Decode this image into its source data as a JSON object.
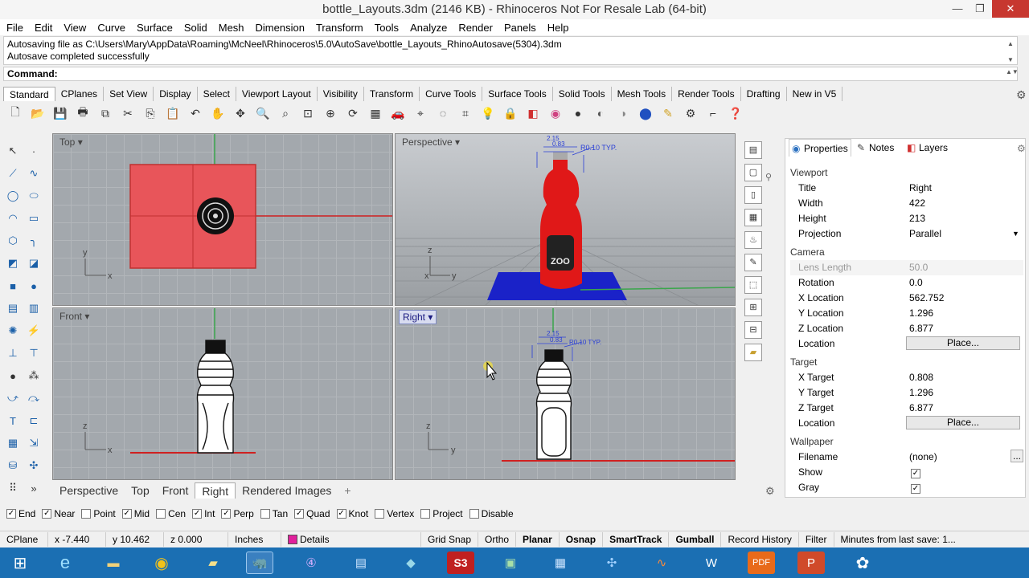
{
  "window": {
    "title": "bottle_Layouts.3dm (2146 KB) - Rhinoceros Not For Resale Lab (64-bit)"
  },
  "menu": [
    "File",
    "Edit",
    "View",
    "Curve",
    "Surface",
    "Solid",
    "Mesh",
    "Dimension",
    "Transform",
    "Tools",
    "Analyze",
    "Render",
    "Panels",
    "Help"
  ],
  "history": {
    "line1": "Autosaving file as C:\\Users\\Mary\\AppData\\Roaming\\McNeel\\Rhinoceros\\5.0\\AutoSave\\bottle_Layouts_RhinoAutosave(5304).3dm",
    "line2": "Autosave completed successfully",
    "command_label": "Command:"
  },
  "toolbar_tabs": [
    "Standard",
    "CPlanes",
    "Set View",
    "Display",
    "Select",
    "Viewport Layout",
    "Visibility",
    "Transform",
    "Curve Tools",
    "Surface Tools",
    "Solid Tools",
    "Mesh Tools",
    "Render Tools",
    "Drafting",
    "New in V5"
  ],
  "toolbar_icons": [
    "new-icon",
    "open-icon",
    "save-icon",
    "print-icon",
    "import-icon",
    "cut-icon",
    "copy-icon",
    "paste-icon",
    "undo-icon",
    "pan-icon",
    "rotate-view-icon",
    "zoom-icon",
    "zoom-window-icon",
    "zoom-extents-icon",
    "zoom-selected-icon",
    "rotate-icon",
    "grid-icon",
    "car-icon",
    "cplane-icon",
    "point-icon",
    "cage-icon",
    "light-icon",
    "lock-icon",
    "layer-icon",
    "color-icon",
    "shaded-icon",
    "rendered-icon",
    "render-icon",
    "sphere-icon",
    "lamp-icon",
    "options-icon",
    "snap-icon",
    "help-icon"
  ],
  "viewports": {
    "top": "Top",
    "perspective": "Perspective",
    "front": "Front",
    "right": "Right",
    "annotation": "R0.10 TYP.",
    "dim1": "2.15",
    "dim2": "0.83",
    "zoo_label": "ZOO"
  },
  "viewport_tabs": [
    "Perspective",
    "Top",
    "Front",
    "Right",
    "Rendered Images"
  ],
  "viewport_tabs_add": "+",
  "osnap": [
    {
      "label": "End",
      "checked": true
    },
    {
      "label": "Near",
      "checked": true
    },
    {
      "label": "Point",
      "checked": false
    },
    {
      "label": "Mid",
      "checked": true
    },
    {
      "label": "Cen",
      "checked": false
    },
    {
      "label": "Int",
      "checked": true
    },
    {
      "label": "Perp",
      "checked": true
    },
    {
      "label": "Tan",
      "checked": false
    },
    {
      "label": "Quad",
      "checked": true
    },
    {
      "label": "Knot",
      "checked": true
    },
    {
      "label": "Vertex",
      "checked": false
    },
    {
      "label": "Project",
      "checked": false
    },
    {
      "label": "Disable",
      "checked": false
    }
  ],
  "status": {
    "cplane": "CPlane",
    "x": "x -7.440",
    "y": "y 10.462",
    "z": "z 0.000",
    "units": "Inches",
    "layer": "Details",
    "layer_color": "#e0209c",
    "grid_snap": "Grid Snap",
    "ortho": "Ortho",
    "planar": "Planar",
    "osnap": "Osnap",
    "smarttrack": "SmartTrack",
    "gumball": "Gumball",
    "record_history": "Record History",
    "filter": "Filter",
    "minutes": "Minutes from last save: 1..."
  },
  "panel": {
    "tabs": [
      "Properties",
      "Notes",
      "Layers"
    ],
    "viewport_section": "Viewport",
    "camera_section": "Camera",
    "target_section": "Target",
    "wallpaper_section": "Wallpaper",
    "rows": {
      "title": {
        "label": "Title",
        "value": "Right"
      },
      "width": {
        "label": "Width",
        "value": "422"
      },
      "height": {
        "label": "Height",
        "value": "213"
      },
      "projection": {
        "label": "Projection",
        "value": "Parallel"
      },
      "lens": {
        "label": "Lens Length",
        "value": "50.0"
      },
      "rotation": {
        "label": "Rotation",
        "value": "0.0"
      },
      "xloc": {
        "label": "X Location",
        "value": "562.752"
      },
      "yloc": {
        "label": "Y Location",
        "value": "1.296"
      },
      "zloc": {
        "label": "Z Location",
        "value": "6.877"
      },
      "location": {
        "label": "Location",
        "value": "Place..."
      },
      "xtgt": {
        "label": "X Target",
        "value": "0.808"
      },
      "ytgt": {
        "label": "Y Target",
        "value": "1.296"
      },
      "ztgt": {
        "label": "Z Target",
        "value": "6.877"
      },
      "tlocation": {
        "label": "Location",
        "value": "Place..."
      },
      "filename": {
        "label": "Filename",
        "value": "(none)"
      },
      "show": {
        "label": "Show",
        "value": "✓"
      },
      "gray": {
        "label": "Gray",
        "value": "✓"
      }
    },
    "ellipsis": "..."
  },
  "colors": {
    "accent": "#1b6fb3",
    "selected_red": "#e8555a",
    "axis_green": "#3aa64b",
    "axis_red": "#d02020"
  }
}
